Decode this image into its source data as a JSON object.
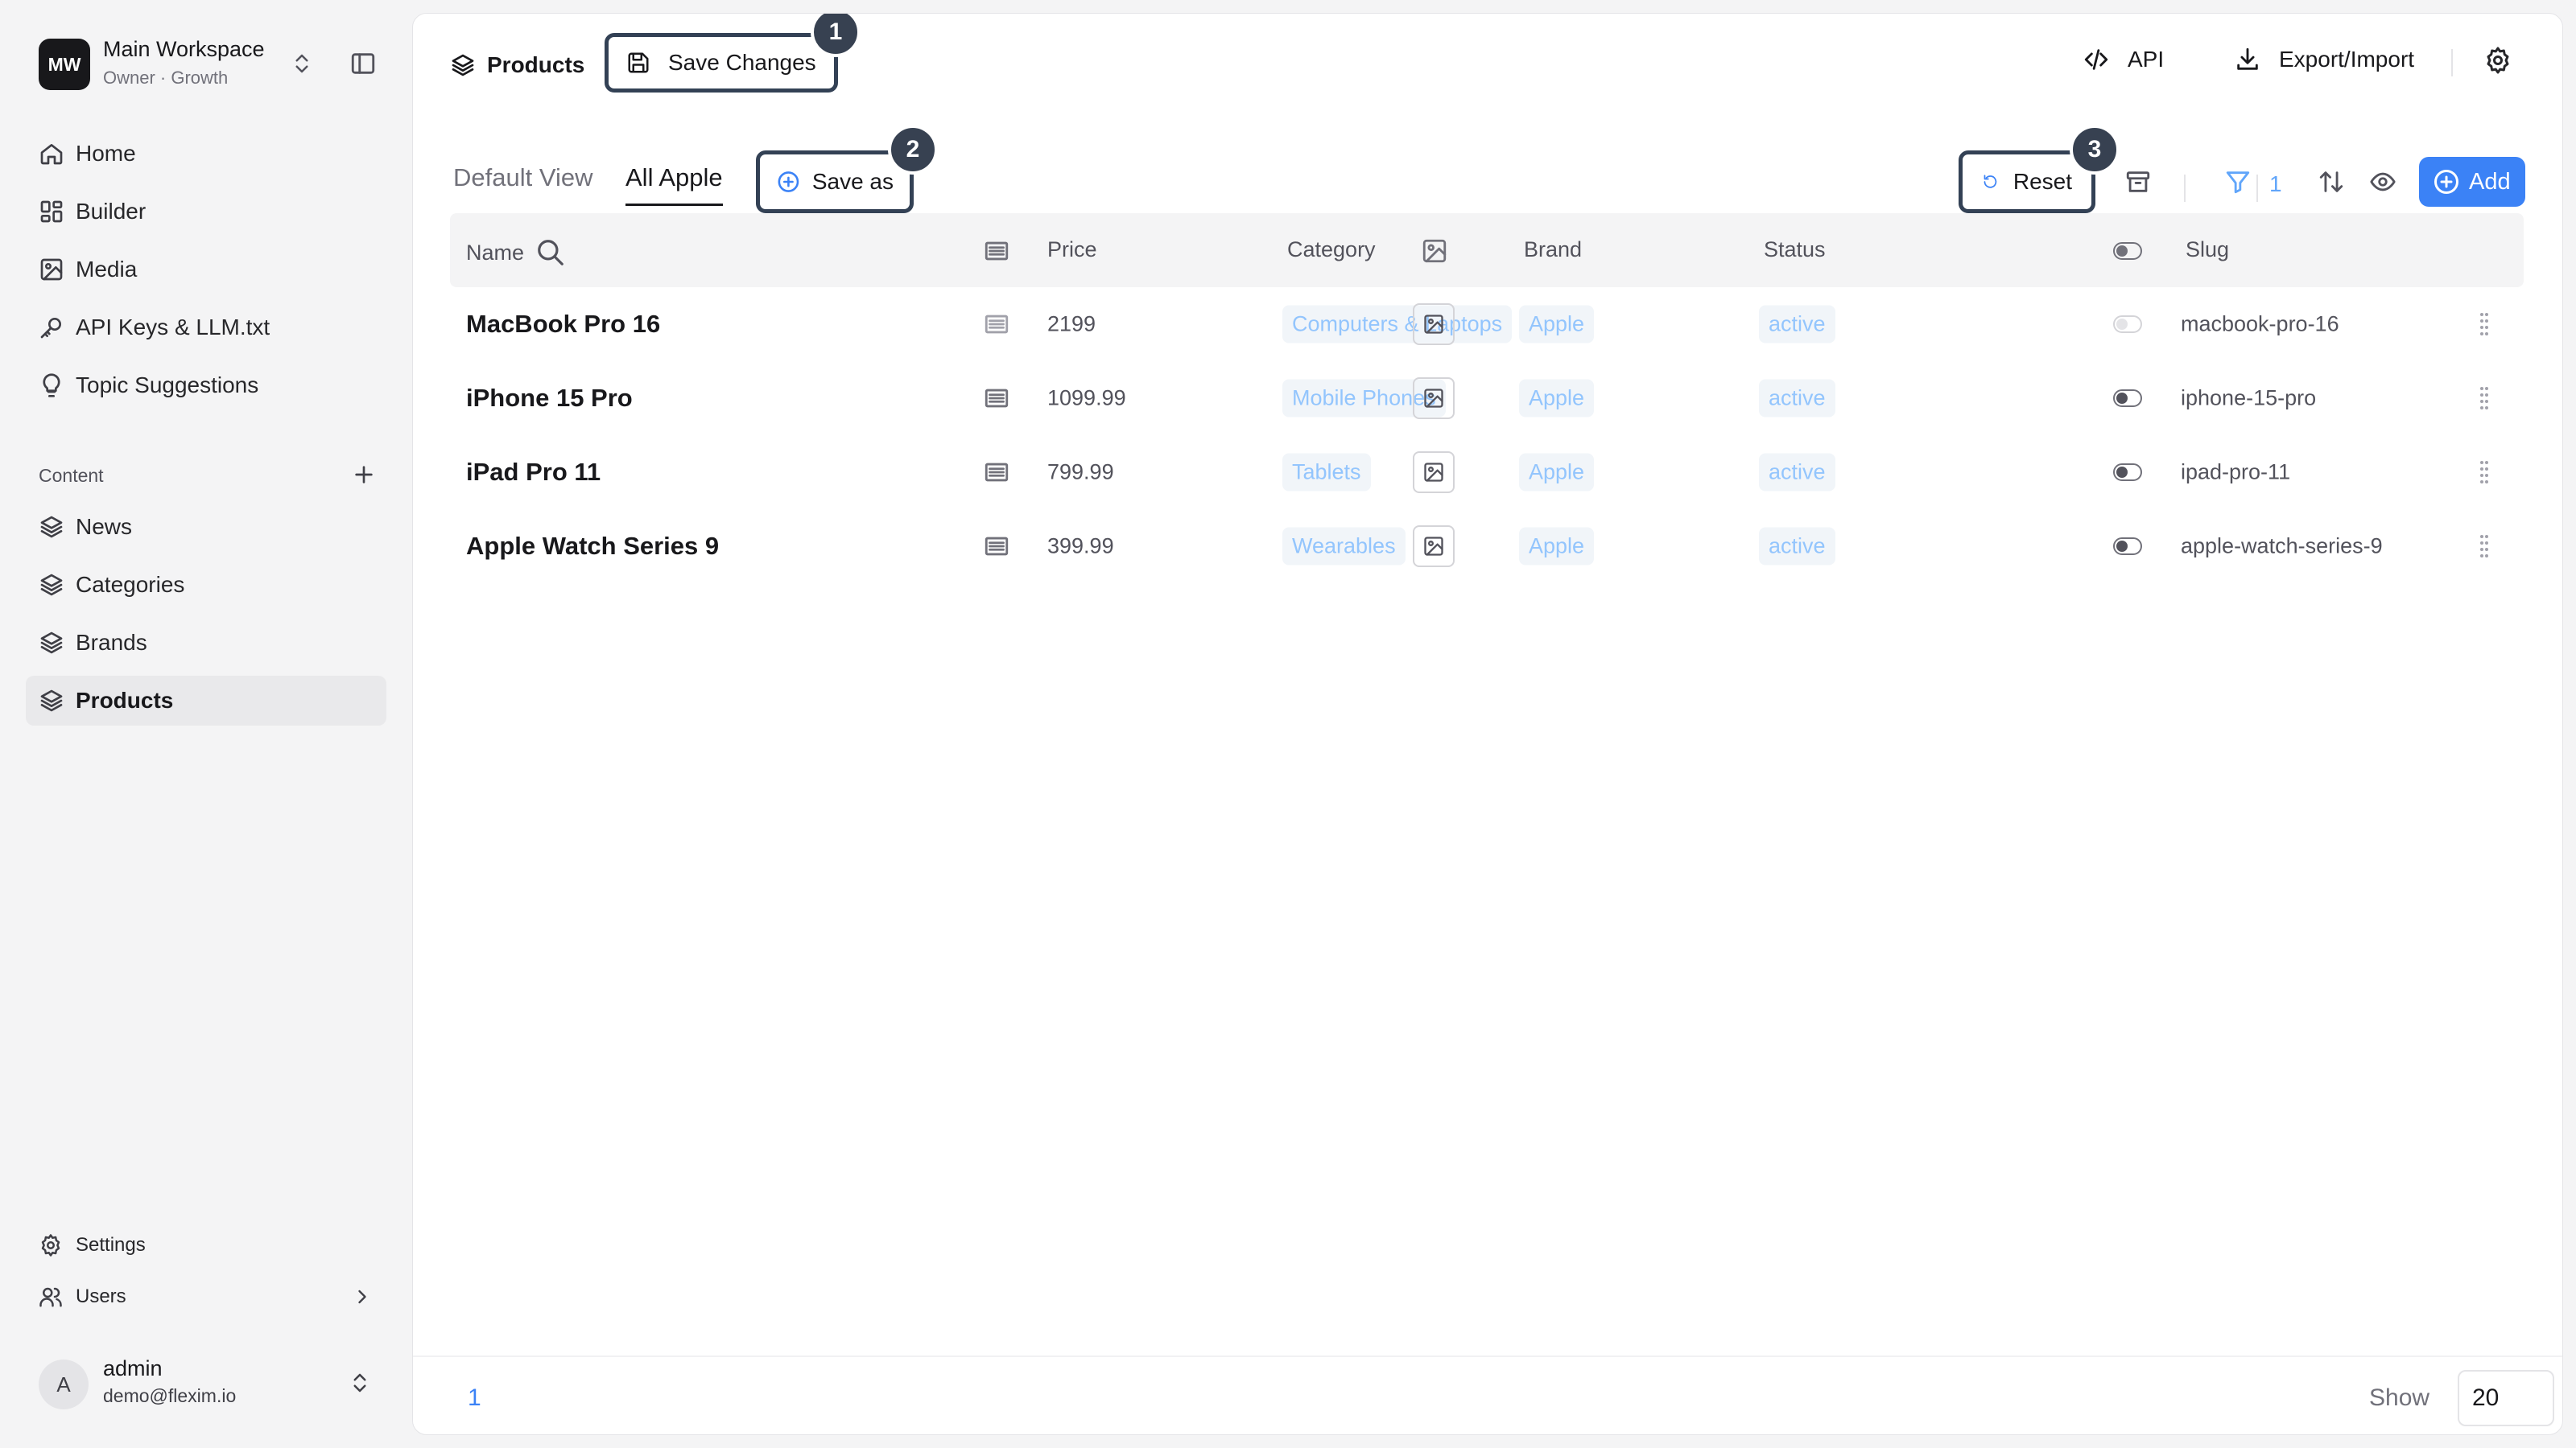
{
  "workspace": {
    "logo": "MW",
    "name": "Main Workspace",
    "subtitle": "Owner · Growth"
  },
  "sidebar": {
    "nav": [
      {
        "label": "Home",
        "icon": "home-icon"
      },
      {
        "label": "Builder",
        "icon": "builder-icon"
      },
      {
        "label": "Media",
        "icon": "image-icon"
      },
      {
        "label": "API Keys & LLM.txt",
        "icon": "key-icon"
      },
      {
        "label": "Topic Suggestions",
        "icon": "lightbulb-icon"
      }
    ],
    "content_section": "Content",
    "content_items": [
      {
        "label": "News",
        "icon": "layers-icon"
      },
      {
        "label": "Categories",
        "icon": "layers-icon"
      },
      {
        "label": "Brands",
        "icon": "layers-icon"
      },
      {
        "label": "Products",
        "icon": "layers-icon",
        "active": true
      }
    ],
    "settings": "Settings",
    "users": "Users"
  },
  "user": {
    "initial": "A",
    "name": "admin",
    "email": "demo@flexim.io"
  },
  "topbar": {
    "breadcrumb": "Products",
    "save_changes": "Save Changes",
    "api": "API",
    "export_import": "Export/Import"
  },
  "views": {
    "tabs": [
      "Default View",
      "All Apple"
    ],
    "active_tab": "All Apple",
    "save_as": "Save as",
    "reset": "Reset",
    "filter_count": "1",
    "add": "Add"
  },
  "annotations": [
    "1",
    "2",
    "3"
  ],
  "table": {
    "columns": {
      "name": "Name",
      "price": "Price",
      "category": "Category",
      "brand": "Brand",
      "status": "Status",
      "slug": "Slug"
    },
    "rows": [
      {
        "name": "MacBook Pro 16",
        "price": "2199",
        "category": "Computers & Laptops",
        "brand": "Apple",
        "status": "active",
        "toggle": false,
        "slug": "macbook-pro-16"
      },
      {
        "name": "iPhone 15 Pro",
        "price": "1099.99",
        "category": "Mobile Phones",
        "brand": "Apple",
        "status": "active",
        "toggle": true,
        "slug": "iphone-15-pro"
      },
      {
        "name": "iPad Pro 11",
        "price": "799.99",
        "category": "Tablets",
        "brand": "Apple",
        "status": "active",
        "toggle": true,
        "slug": "ipad-pro-11"
      },
      {
        "name": "Apple Watch Series 9",
        "price": "399.99",
        "category": "Wearables",
        "brand": "Apple",
        "status": "active",
        "toggle": true,
        "slug": "apple-watch-series-9"
      }
    ]
  },
  "footer": {
    "page": "1",
    "show_label": "Show",
    "page_size": "20"
  },
  "colors": {
    "accent": "#3b82f6",
    "chip_text": "#93c5fd",
    "annotation": "#374151"
  }
}
